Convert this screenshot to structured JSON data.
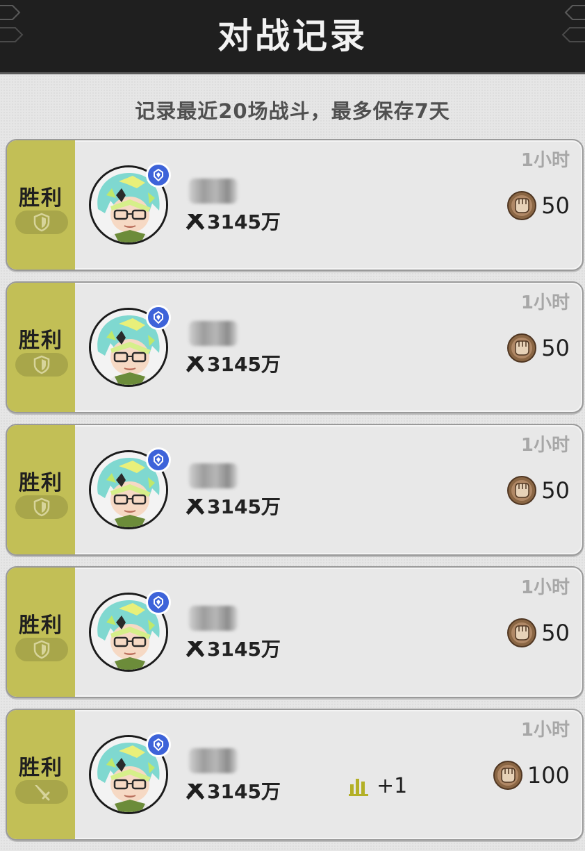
{
  "header": {
    "title": "对战记录"
  },
  "subtitle": "记录最近20场战斗，最多保存7天",
  "colors": {
    "header_bg": "#1f1f1f",
    "result_win": "#c2bf56",
    "rank_badge": "#3d63d9",
    "coin": "#7a5a3c"
  },
  "records": [
    {
      "result": "胜利",
      "result_icon": "shield-icon",
      "power": "3145万",
      "time": "1小时",
      "reward": "50"
    },
    {
      "result": "胜利",
      "result_icon": "shield-icon",
      "power": "3145万",
      "time": "1小时",
      "reward": "50"
    },
    {
      "result": "胜利",
      "result_icon": "shield-icon",
      "power": "3145万",
      "time": "1小时",
      "reward": "50"
    },
    {
      "result": "胜利",
      "result_icon": "shield-icon",
      "power": "3145万",
      "time": "1小时",
      "reward": "50"
    },
    {
      "result": "胜利",
      "result_icon": "sword-icon",
      "power": "3145万",
      "time": "1小时",
      "reward": "100",
      "rank_change": "+1"
    }
  ]
}
